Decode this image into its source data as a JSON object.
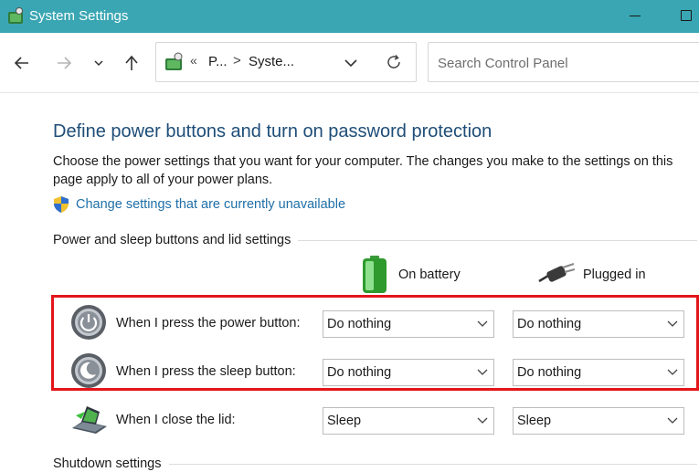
{
  "window": {
    "title": "System Settings"
  },
  "nav": {
    "back_icon": "arrow-left-icon",
    "forward_icon": "arrow-right-icon",
    "recent_icon": "chevron-down-icon",
    "up_icon": "arrow-up-icon",
    "breadcrumb": {
      "overflow": "«",
      "items": [
        "P...",
        "Syste..."
      ],
      "separator": ">"
    },
    "search_placeholder": "Search Control Panel"
  },
  "main": {
    "heading": "Define power buttons and turn on password protection",
    "description": "Choose the power settings that you want for your computer. The changes you make to the settings on this page apply to all of your power plans.",
    "change_link": "Change settings that are currently unavailable",
    "sections": {
      "buttons_lid": "Power and sleep buttons and lid settings",
      "shutdown": "Shutdown settings"
    },
    "columns": {
      "battery": "On battery",
      "plugged": "Plugged in"
    },
    "rows": [
      {
        "label": "When I press the power button:",
        "battery": "Do nothing",
        "plugged": "Do nothing",
        "icon": "power-button-icon"
      },
      {
        "label": "When I press the sleep button:",
        "battery": "Do nothing",
        "plugged": "Do nothing",
        "icon": "sleep-button-icon"
      },
      {
        "label": "When I close the lid:",
        "battery": "Sleep",
        "plugged": "Sleep",
        "icon": "laptop-lid-icon"
      }
    ]
  },
  "colors": {
    "titlebar": "#3aa6b3",
    "heading": "#1e4d78",
    "link": "#1f6fa8",
    "highlight": "#e3151a"
  }
}
